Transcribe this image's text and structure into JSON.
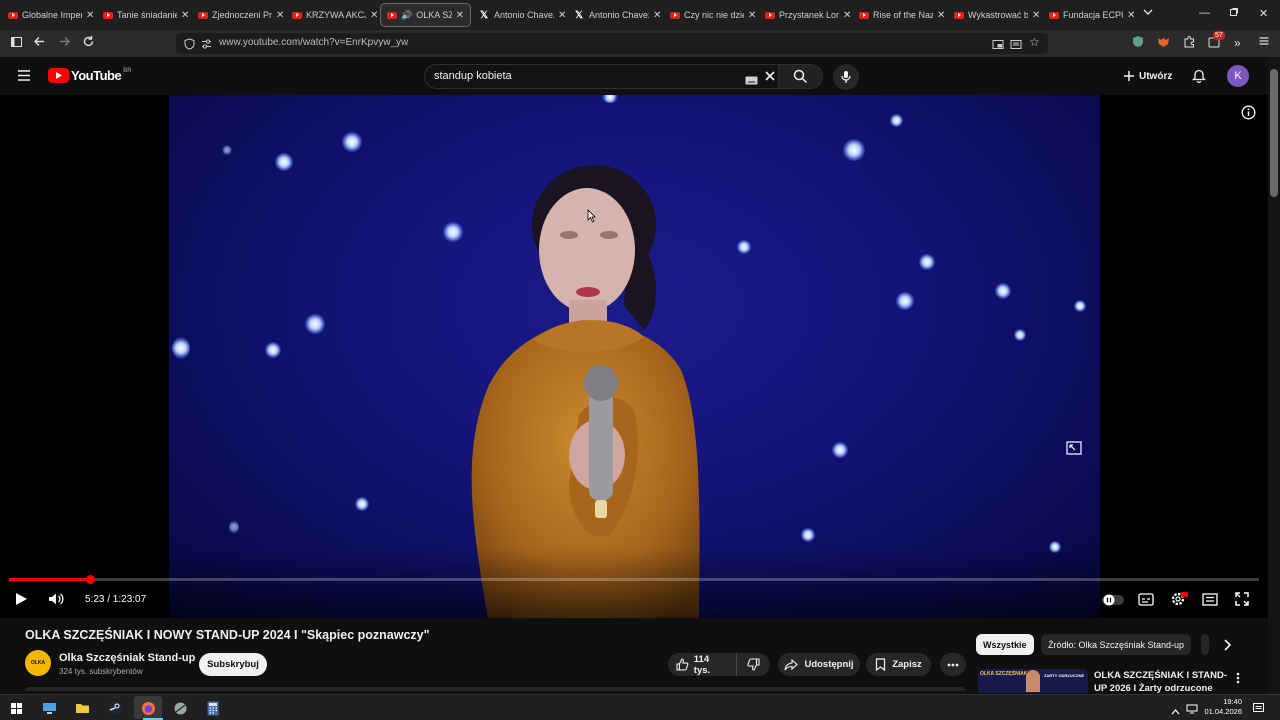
{
  "browser": {
    "tabs": [
      {
        "label": "Globalne Imperi",
        "icon": "youtube-icon"
      },
      {
        "label": "Tanie śniadanie",
        "icon": "youtube-icon"
      },
      {
        "label": "Zjednoczeni Prz",
        "icon": "youtube-icon"
      },
      {
        "label": "KRZYWA AKCJA",
        "icon": "youtube-icon"
      },
      {
        "label": "OLKA SZCZ",
        "icon": "youtube-icon",
        "active": true,
        "audio": true
      },
      {
        "label": "Antonio Chavez",
        "icon": "x-icon"
      },
      {
        "label": "Antonio Chavez",
        "icon": "x-icon"
      },
      {
        "label": "Czy nic nie dzie",
        "icon": "youtube-icon"
      },
      {
        "label": "Przystanek Lom",
        "icon": "youtube-icon"
      },
      {
        "label": "Rise of the Nazi",
        "icon": "youtube-icon"
      },
      {
        "label": "Wykastrować b",
        "icon": "youtube-icon"
      },
      {
        "label": "Fundacja ECPU",
        "icon": "youtube-icon"
      }
    ],
    "url": "www.youtube.com/watch?v=EnrKpvyw_yw",
    "extension_badge": "57"
  },
  "youtube": {
    "logo_text": "YouTube",
    "region": "BR",
    "search_query": "standup kobieta",
    "create_label": "Utwórz",
    "avatar_letter": "K"
  },
  "player": {
    "current_time": "5:23",
    "duration": "1:23:07",
    "time_display": "5:23 / 1:23:07",
    "progress_fraction": 0.0648
  },
  "video": {
    "title": "OLKA SZCZĘŚNIAK I NOWY STAND-UP 2024 I \"Skąpiec poznawczy\"",
    "channel_name": "Olka Szczęśniak Stand-up",
    "channel_avatar_text": "OLKA",
    "subscribers": "324 tys. subskrybentów",
    "subscribe_label": "Subskrybuj",
    "likes": "114 tys.",
    "share_label": "Udostępnij",
    "save_label": "Zapisz"
  },
  "sidebar": {
    "chips": [
      "Wszystkie",
      "Źródło: Olka Szczęśniak Stand-up"
    ],
    "related": [
      {
        "title": "OLKA SZCZĘŚNIAK I STAND-UP 2026 I Żarty odrzucone",
        "thumb_text_a": "OLKA SZCZĘŚNIAK",
        "thumb_text_b": "ŻARTY ODRZUCONE"
      }
    ]
  },
  "taskbar": {
    "time": "19:40",
    "date": "01.04.2026"
  },
  "colors": {
    "youtube_red": "#ff0000",
    "background": "#0f0f0f",
    "avatar": "#7e57c2"
  }
}
